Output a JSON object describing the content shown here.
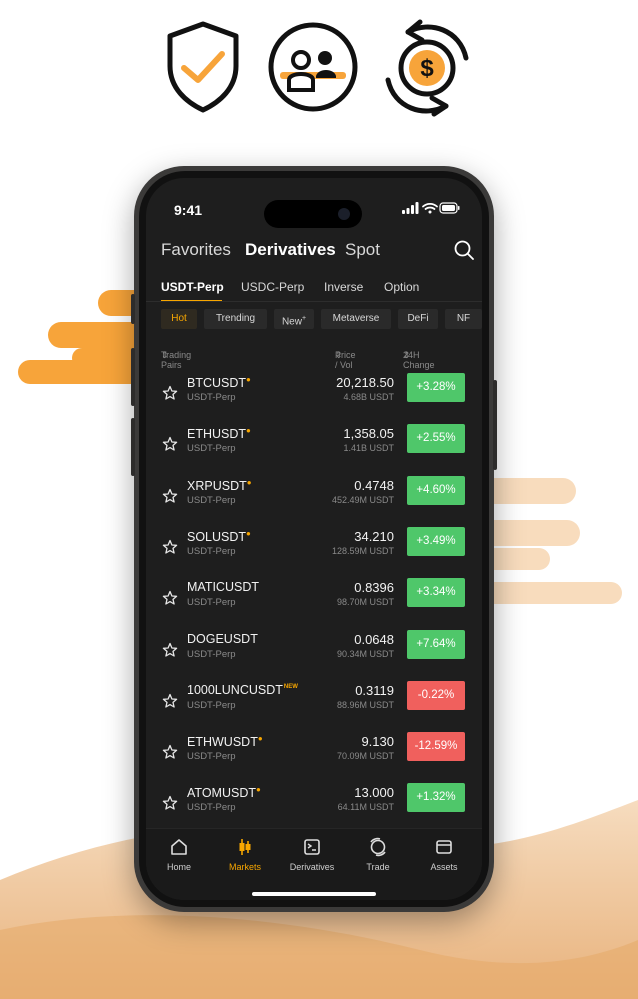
{
  "colors": {
    "accent": "#f7a600",
    "up": "#20b26c",
    "down": "#ef454a",
    "screen_bg": "#1e1e1e"
  },
  "feature_icons": [
    "shield-check-icon",
    "users-icon",
    "dollar-exchange-icon"
  ],
  "status_bar": {
    "time": "9:41"
  },
  "nav_tabs": [
    "Favorites",
    "Derivatives",
    "Spot"
  ],
  "sub_tabs": [
    "USDT-Perp",
    "USDC-Perp",
    "Inverse",
    "Option"
  ],
  "chips": [
    "Hot",
    "Trending",
    "New",
    "Metaverse",
    "DeFi",
    "NF"
  ],
  "chip_new_marker": "+",
  "columns": {
    "pairs": "Trading Pairs",
    "price_vol": "Price / Vol",
    "change": "24H Change"
  },
  "rows": [
    {
      "pair": "BTCUSDT",
      "badge": "fire",
      "type": "USDT-Perp",
      "price": "20,218.50",
      "vol": "4.68B USDT",
      "change": "+3.28%",
      "dir": "up"
    },
    {
      "pair": "ETHUSDT",
      "badge": "fire",
      "type": "USDT-Perp",
      "price": "1,358.05",
      "vol": "1.41B USDT",
      "change": "+2.55%",
      "dir": "up"
    },
    {
      "pair": "XRPUSDT",
      "badge": "fire",
      "type": "USDT-Perp",
      "price": "0.4748",
      "vol": "452.49M USDT",
      "change": "+4.60%",
      "dir": "up"
    },
    {
      "pair": "SOLUSDT",
      "badge": "fire",
      "type": "USDT-Perp",
      "price": "34.210",
      "vol": "128.59M USDT",
      "change": "+3.49%",
      "dir": "up"
    },
    {
      "pair": "MATICUSDT",
      "badge": "",
      "type": "USDT-Perp",
      "price": "0.8396",
      "vol": "98.70M USDT",
      "change": "+3.34%",
      "dir": "up"
    },
    {
      "pair": "DOGEUSDT",
      "badge": "",
      "type": "USDT-Perp",
      "price": "0.0648",
      "vol": "90.34M USDT",
      "change": "+7.64%",
      "dir": "up"
    },
    {
      "pair": "1000LUNCUSDT",
      "badge": "new",
      "badge_text": "NEW",
      "type": "USDT-Perp",
      "price": "0.3119",
      "vol": "88.96M USDT",
      "change": "-0.22%",
      "dir": "down"
    },
    {
      "pair": "ETHWUSDT",
      "badge": "fire",
      "type": "USDT-Perp",
      "price": "9.130",
      "vol": "70.09M USDT",
      "change": "-12.59%",
      "dir": "down"
    },
    {
      "pair": "ATOMUSDT",
      "badge": "fire",
      "type": "USDT-Perp",
      "price": "13.000",
      "vol": "64.11M USDT",
      "change": "+1.32%",
      "dir": "up"
    }
  ],
  "bottom_nav": [
    {
      "label": "Home",
      "icon": "home-icon"
    },
    {
      "label": "Markets",
      "icon": "candlestick-icon",
      "active": true
    },
    {
      "label": "Derivatives",
      "icon": "derivatives-icon"
    },
    {
      "label": "Trade",
      "icon": "trade-icon"
    },
    {
      "label": "Assets",
      "icon": "wallet-icon"
    }
  ]
}
